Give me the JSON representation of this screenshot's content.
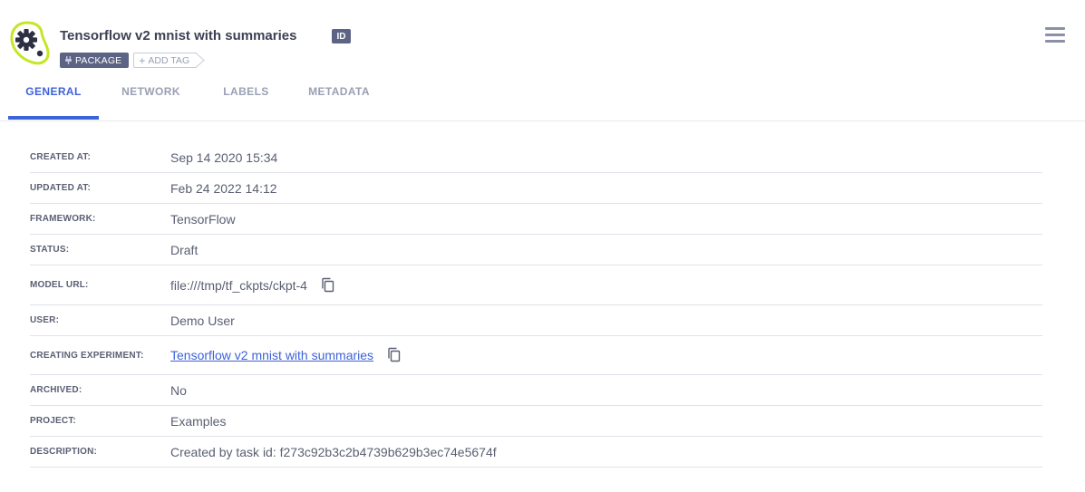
{
  "header": {
    "title": "Tensorflow v2 mnist with summaries",
    "id_badge": "ID",
    "tags": [
      "PACKAGE"
    ],
    "add_tag_label": "ADD TAG"
  },
  "tabs": [
    {
      "label": "GENERAL",
      "active": true
    },
    {
      "label": "NETWORK",
      "active": false
    },
    {
      "label": "LABELS",
      "active": false
    },
    {
      "label": "METADATA",
      "active": false
    }
  ],
  "details": {
    "created_at": {
      "label": "CREATED AT:",
      "value": "Sep 14 2020 15:34"
    },
    "updated_at": {
      "label": "UPDATED AT:",
      "value": "Feb 24 2022 14:12"
    },
    "framework": {
      "label": "FRAMEWORK:",
      "value": "TensorFlow"
    },
    "status": {
      "label": "STATUS:",
      "value": "Draft"
    },
    "model_url": {
      "label": "MODEL URL:",
      "value": "file:///tmp/tf_ckpts/ckpt-4"
    },
    "user": {
      "label": "USER:",
      "value": "Demo User"
    },
    "creating_experiment": {
      "label": "CREATING EXPERIMENT:",
      "value": "Tensorflow v2 mnist with summaries"
    },
    "archived": {
      "label": "ARCHIVED:",
      "value": "No"
    },
    "project": {
      "label": "PROJECT:",
      "value": "Examples"
    },
    "description": {
      "label": "DESCRIPTION:",
      "value": "Created by task id: f273c92b3c2b4739b629b3ec74e5674f"
    }
  },
  "colors": {
    "accent": "#3e62d8",
    "badge": "#5c6384",
    "icon_ring": "#c5e625",
    "text": "#5a5f72"
  },
  "icons": {
    "model": "gear-icon",
    "menu": "hamburger-menu-icon",
    "copy": "copy-icon",
    "plug": "plug-icon",
    "plus": "plus-icon"
  }
}
